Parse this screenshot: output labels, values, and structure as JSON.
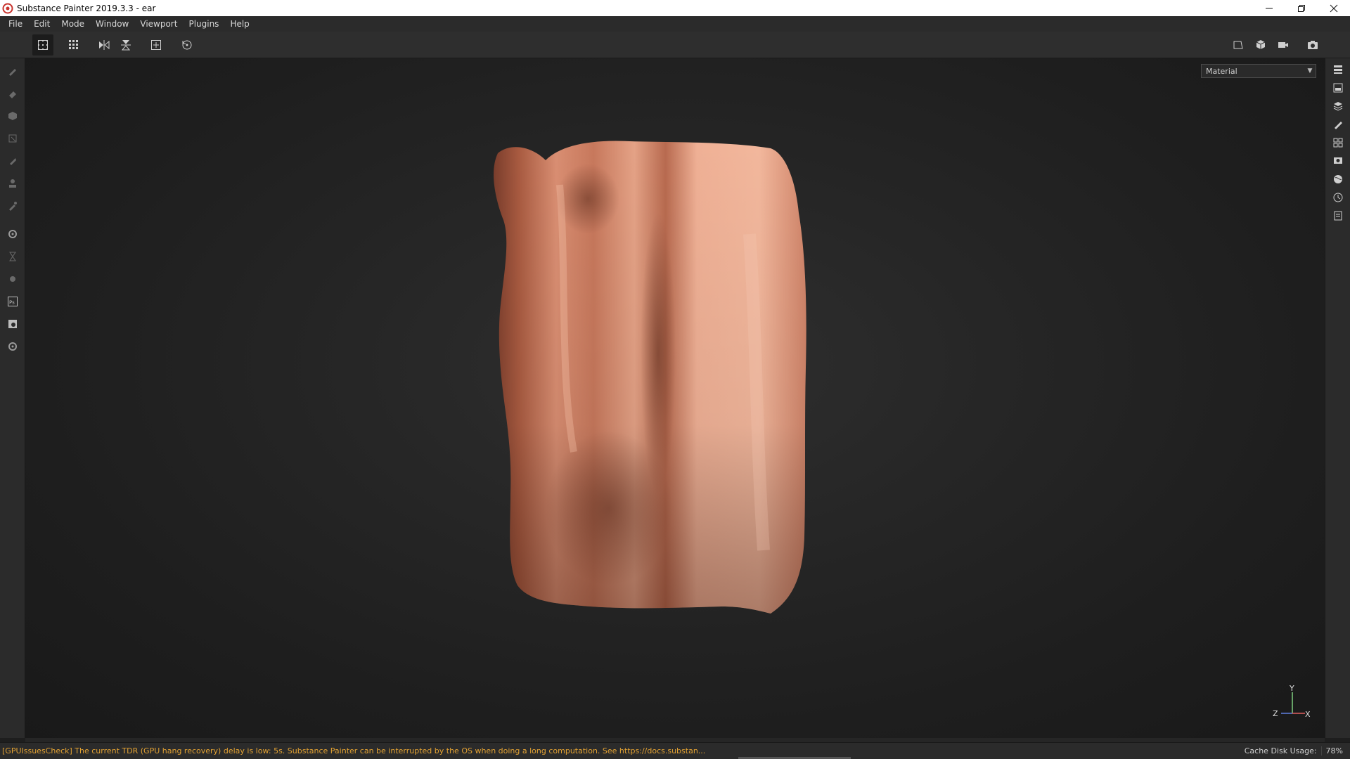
{
  "window": {
    "title": "Substance Painter 2019.3.3 - ear",
    "controls": [
      "minimize-icon",
      "restore-icon",
      "close-icon"
    ]
  },
  "menu": {
    "items": [
      "File",
      "Edit",
      "Mode",
      "Window",
      "Viewport",
      "Plugins",
      "Help"
    ]
  },
  "toolbar": {
    "left_icons": [
      "grid-selection-icon",
      "grid-options-icon",
      "mirror-x-icon",
      "mirror-y-icon",
      "add-frame-icon",
      "reset-icon"
    ],
    "right_icons": [
      "view-2d-icon",
      "view-3d-icon",
      "camera-icon",
      "screenshot-icon"
    ]
  },
  "left_tools": [
    "paint-brush-icon",
    "eraser-icon",
    "projection-icon",
    "polygon-fill-icon",
    "smudge-icon",
    "clone-stamp-icon",
    "color-picker-icon",
    "bake-settings-icon",
    "hourglass-icon",
    "substance-icon",
    "photoshop-icon",
    "export-icon",
    "settings-icon"
  ],
  "right_panels": [
    "layers-panel-icon",
    "texture-set-icon",
    "layer-stack-icon",
    "properties-icon",
    "texture-set-settings-icon",
    "display-settings-icon",
    "shader-settings-icon",
    "history-icon",
    "log-icon"
  ],
  "viewport": {
    "channel_select": {
      "value": "Material"
    },
    "gizmo": {
      "y": "Y",
      "z": "Z",
      "x": "X"
    }
  },
  "status": {
    "message": "[GPUIssuesCheck] The current TDR (GPU hang recovery) delay is low: 5s. Substance Painter can be interrupted by the OS when doing a long computation. See https://docs.substan...",
    "cache_label": "Cache Disk Usage:",
    "cache_value": "78%"
  },
  "colors": {
    "accent_warning": "#e3a233",
    "skin_light": "#f0b39a",
    "skin_shadow": "#8a4a35"
  }
}
